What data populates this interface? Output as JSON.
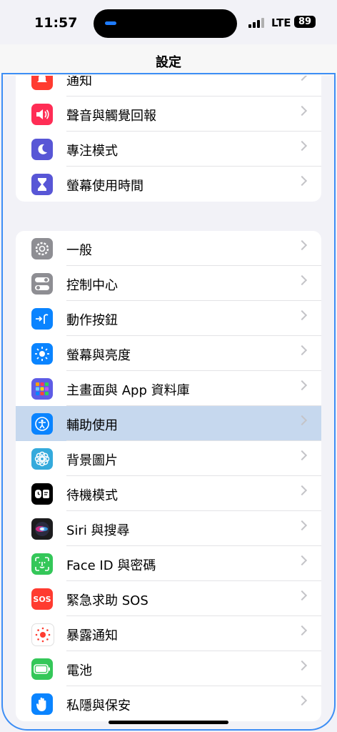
{
  "status": {
    "time": "11:57",
    "network": "LTE",
    "battery": "89"
  },
  "nav": {
    "title": "設定"
  },
  "group1": [
    {
      "label": "通知",
      "icon": "bell-icon",
      "color": "#ff3b30"
    },
    {
      "label": "聲音與觸覺回報",
      "icon": "speaker-icon",
      "color": "#ff2d55"
    },
    {
      "label": "專注模式",
      "icon": "moon-icon",
      "color": "#5856d6"
    },
    {
      "label": "螢幕使用時間",
      "icon": "hourglass-icon",
      "color": "#5856d6"
    }
  ],
  "group2": [
    {
      "label": "一般",
      "icon": "gear-icon",
      "color": "#8e8e93"
    },
    {
      "label": "控制中心",
      "icon": "toggles-icon",
      "color": "#8e8e93"
    },
    {
      "label": "動作按鈕",
      "icon": "action-button-icon",
      "color": "#0a84ff"
    },
    {
      "label": "螢幕與亮度",
      "icon": "sun-icon",
      "color": "#0a84ff"
    },
    {
      "label": "主畫面與 App 資料庫",
      "icon": "app-grid-icon",
      "color": "#5e5ce6"
    },
    {
      "label": "輔助使用",
      "icon": "accessibility-icon",
      "color": "#0a84ff",
      "selected": true
    },
    {
      "label": "背景圖片",
      "icon": "flower-icon",
      "color": "#34aadc"
    },
    {
      "label": "待機模式",
      "icon": "standby-icon",
      "color": "#000000"
    },
    {
      "label": "Siri 與搜尋",
      "icon": "siri-icon",
      "color": "#1c1c1e"
    },
    {
      "label": "Face ID 與密碼",
      "icon": "faceid-icon",
      "color": "#34c759"
    },
    {
      "label": "緊急求助 SOS",
      "icon": "sos-icon",
      "color": "#ff3b30"
    },
    {
      "label": "暴露通知",
      "icon": "exposure-icon",
      "color": "#ffffff"
    },
    {
      "label": "電池",
      "icon": "battery-icon",
      "color": "#34c759"
    },
    {
      "label": "私隱與保安",
      "icon": "hand-icon",
      "color": "#0a84ff"
    }
  ],
  "icon_texts": {
    "sos": "SOS"
  }
}
